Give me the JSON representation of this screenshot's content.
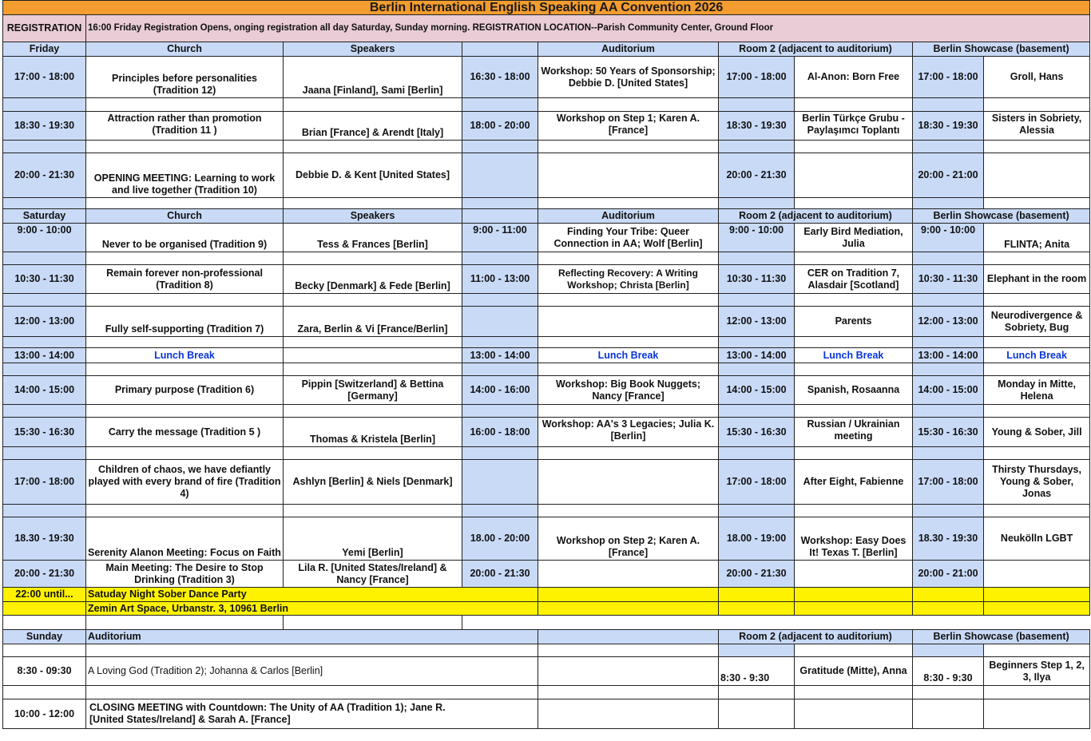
{
  "title": "Berlin International English Speaking AA Convention 2026",
  "registration": {
    "label": "REGISTRATION",
    "text": "16:00 Friday Registration Opens, onging registration all day Saturday, Sunday morning.  REGISTRATION LOCATION--Parish Community Center, Ground Floor"
  },
  "friday": {
    "header": [
      "Friday",
      "Church",
      "Speakers",
      "",
      "Auditorium",
      "Room 2 (adjacent to auditorium)",
      "Berlin Showcase (basement)"
    ],
    "rows": [
      [
        "17:00 - 18:00",
        "Principles before personalities (Tradition 12)",
        "Jaana [Finland], Sami [Berlin]",
        "16:30 - 18:00",
        "Workshop: 50 Years of Sponsorship; Debbie D. [United States]",
        "17:00 - 18:00",
        "Al-Anon: Born Free",
        "17:00 - 18:00",
        "Groll, Hans"
      ],
      [
        "18:30 - 19:30",
        "Attraction rather than promotion (Tradition 11 )",
        "Brian [France] & Arendt [Italy]",
        "18:00 - 20:00",
        "Workshop on Step 1; Karen A. [France]",
        "18:30 - 19:30",
        "Berlin Türkçe Grubu - Paylaşımcı Toplantı",
        "18:30 - 19:30",
        "Sisters in Sobriety, Alessia"
      ],
      [
        "20:00 - 21:30",
        "OPENING MEETING: Learning to work and live together (Tradition 10)",
        "Debbie D. & Kent [United States]",
        "",
        "",
        "20:00 - 21:30",
        "",
        "20:00 - 21:00",
        ""
      ]
    ]
  },
  "saturday": {
    "header": [
      "Saturday",
      "Church",
      "Speakers",
      "",
      "Auditorium",
      "Room 2 (adjacent to auditorium)",
      "Berlin Showcase (basement)"
    ],
    "rows": [
      [
        "9:00 - 10:00",
        "Never to be organised (Tradition 9)",
        "Tess & Frances [Berlin]",
        "9:00 - 11:00",
        "Finding Your Tribe: Queer Connection in AA; Wolf [Berlin]",
        "9:00 - 10:00",
        "Early Bird Mediation, Julia",
        "9:00 - 10:00",
        "FLINTA; Anita"
      ],
      [
        "10:30 - 11:30",
        "Remain forever non-professional (Tradition 8)",
        "Becky [Denmark] & Fede [Berlin]",
        "11:00 - 13:00",
        "Reflecting Recovery: A Writing Workshop; Christa [Berlin]",
        "10:30 - 11:30",
        "CER on Tradition 7, Alasdair [Scotland]",
        "10:30 - 11:30",
        "Elephant in the room"
      ],
      [
        "12:00 - 13:00",
        "Fully self-supporting (Tradition 7)",
        "Zara, Berlin & Vi [France/Berlin]",
        "",
        "",
        "12:00 - 13:00",
        "Parents",
        "12:00 - 13:00",
        "Neurodivergence & Sobriety, Bug"
      ],
      [
        "13:00 - 14:00",
        "Lunch Break",
        "",
        "13:00 - 14:00",
        "Lunch Break",
        "13:00 - 14:00",
        "Lunch Break",
        "13:00 - 14:00",
        "Lunch Break"
      ],
      [
        "14:00 - 15:00",
        "Primary purpose (Tradition 6)",
        "Pippin [Switzerland] & Bettina [Germany]",
        "14:00 - 16:00",
        "Workshop: Big Book Nuggets; Nancy [France]",
        "14:00 - 15:00",
        "Spanish, Rosaanna",
        "14:00 - 15:00",
        "Monday in Mitte, Helena"
      ],
      [
        "15:30 - 16:30",
        "Carry the message (Tradition 5 )",
        "Thomas & Kristela [Berlin]",
        "16:00 - 18:00",
        "Workshop: AA's 3 Legacies; Julia K. [Berlin]",
        "15:30 - 16:30",
        "Russian / Ukrainian meeting",
        "15:30 - 16:30",
        "Young & Sober, Jill"
      ],
      [
        "17:00 - 18:00",
        "Children of chaos, we have defiantly played with every brand of fire (Tradition 4)",
        "Ashlyn [Berlin] & Niels [Denmark]",
        "",
        "",
        "17:00 - 18:00",
        "After Eight, Fabienne",
        "17:00 - 18:00",
        "Thirsty Thursdays, Young & Sober, Jonas"
      ],
      [
        "18.30 - 19:30",
        "Serenity Alanon Meeting: Focus on Faith",
        "Yemi [Berlin]",
        "18.00 - 20:00",
        "Workshop on Step 2; Karen A. [France]",
        "18.00 - 19:00",
        "Workshop: Easy Does It! Texas T. [Berlin]",
        "18.30 - 19:30",
        "Neukölln LGBT"
      ],
      [
        "20:00 - 21:30",
        "Main Meeting: The Desire to Stop Drinking (Tradition 3)",
        "Lila R. [United States/Ireland] & Nancy [France]",
        "20:00 - 21:30",
        "",
        "20:00 - 21:30",
        "",
        "20:00 - 21:00",
        ""
      ]
    ],
    "party_time": "22:00 until...",
    "party_name": "Satuday Night Sober Dance Party",
    "party_location": "Zemin Art Space, Urbanstr. 3, 10961 Berlin"
  },
  "sunday": {
    "header": [
      "Sunday",
      "Auditorium",
      "Room 2 (adjacent to auditorium)",
      "Berlin Showcase (basement)"
    ],
    "rows": [
      [
        "8:30 - 09:30",
        "A Loving God (Tradition 2); Johanna & Carlos [Berlin]",
        "8:30 - 9:30",
        "Gratitude (Mitte), Anna",
        "8:30 - 9:30",
        "Beginners Step 1, 2, 3, Ilya"
      ],
      [
        "10:00 - 12:00",
        "CLOSING MEETING with Countdown: The Unity of AA (Tradition 1); Jane R. [United States/Ireland] & Sarah A. [France]",
        "",
        "",
        "",
        ""
      ]
    ]
  },
  "colors": {
    "title_bar": "#f39c2f",
    "registration_bar": "#e9ccd5",
    "header_cells": "#c9daf7",
    "party_rows": "#fff200",
    "lunch_text": "#0a35d9"
  }
}
